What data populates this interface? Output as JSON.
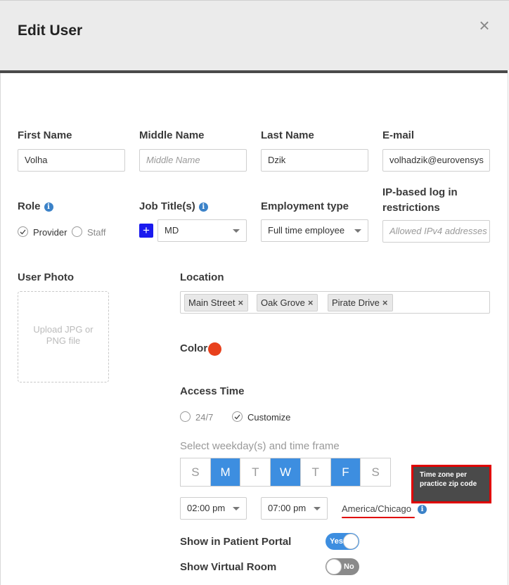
{
  "dialog": {
    "title": "Edit User",
    "close_label": "×"
  },
  "first_name": {
    "label": "First Name",
    "value": "Volha"
  },
  "middle_name": {
    "label": "Middle Name",
    "placeholder": "Middle Name"
  },
  "last_name": {
    "label": "Last Name",
    "value": "Dzik"
  },
  "email": {
    "label": "E-mail",
    "value": "volhadzik@eurovensys"
  },
  "role": {
    "label": "Role",
    "options": [
      "Provider",
      "Staff"
    ],
    "selected": "Provider"
  },
  "job_title": {
    "label": "Job Title(s)",
    "add_label": "+",
    "value": "MD"
  },
  "employment": {
    "label": "Employment type",
    "value": "Full time employee"
  },
  "ip_restrictions": {
    "label_line1": "IP-based log in",
    "label_line2": "restrictions",
    "placeholder": "Allowed IPv4 addresses"
  },
  "photo": {
    "label": "User Photo",
    "upload_line1": "Upload JPG or",
    "upload_line2": "PNG file"
  },
  "location": {
    "label": "Location",
    "tags": [
      "Main Street",
      "Oak Grove",
      "Pirate Drive"
    ]
  },
  "color": {
    "label": "Color",
    "value": "#e8401c"
  },
  "access_time": {
    "label": "Access Time",
    "options": [
      "24/7",
      "Customize"
    ],
    "selected": "Customize",
    "hint": "Select weekday(s) and time frame",
    "days": [
      {
        "label": "S",
        "on": false
      },
      {
        "label": "M",
        "on": true
      },
      {
        "label": "T",
        "on": false
      },
      {
        "label": "W",
        "on": true
      },
      {
        "label": "T",
        "on": false
      },
      {
        "label": "F",
        "on": true
      },
      {
        "label": "S",
        "on": false
      }
    ],
    "start": "02:00 pm",
    "end": "07:00 pm",
    "timezone": "America/Chicago",
    "tooltip_line1": "Time zone per",
    "tooltip_line2": "practice zip code"
  },
  "patient_portal": {
    "label": "Show in Patient Portal",
    "state": "Yes"
  },
  "virtual_room": {
    "label": "Show Virtual Room",
    "state": "No"
  },
  "colors": {
    "accent": "#3d8ee0",
    "header_bg": "#ebebeb",
    "annotation": "#e00000"
  }
}
